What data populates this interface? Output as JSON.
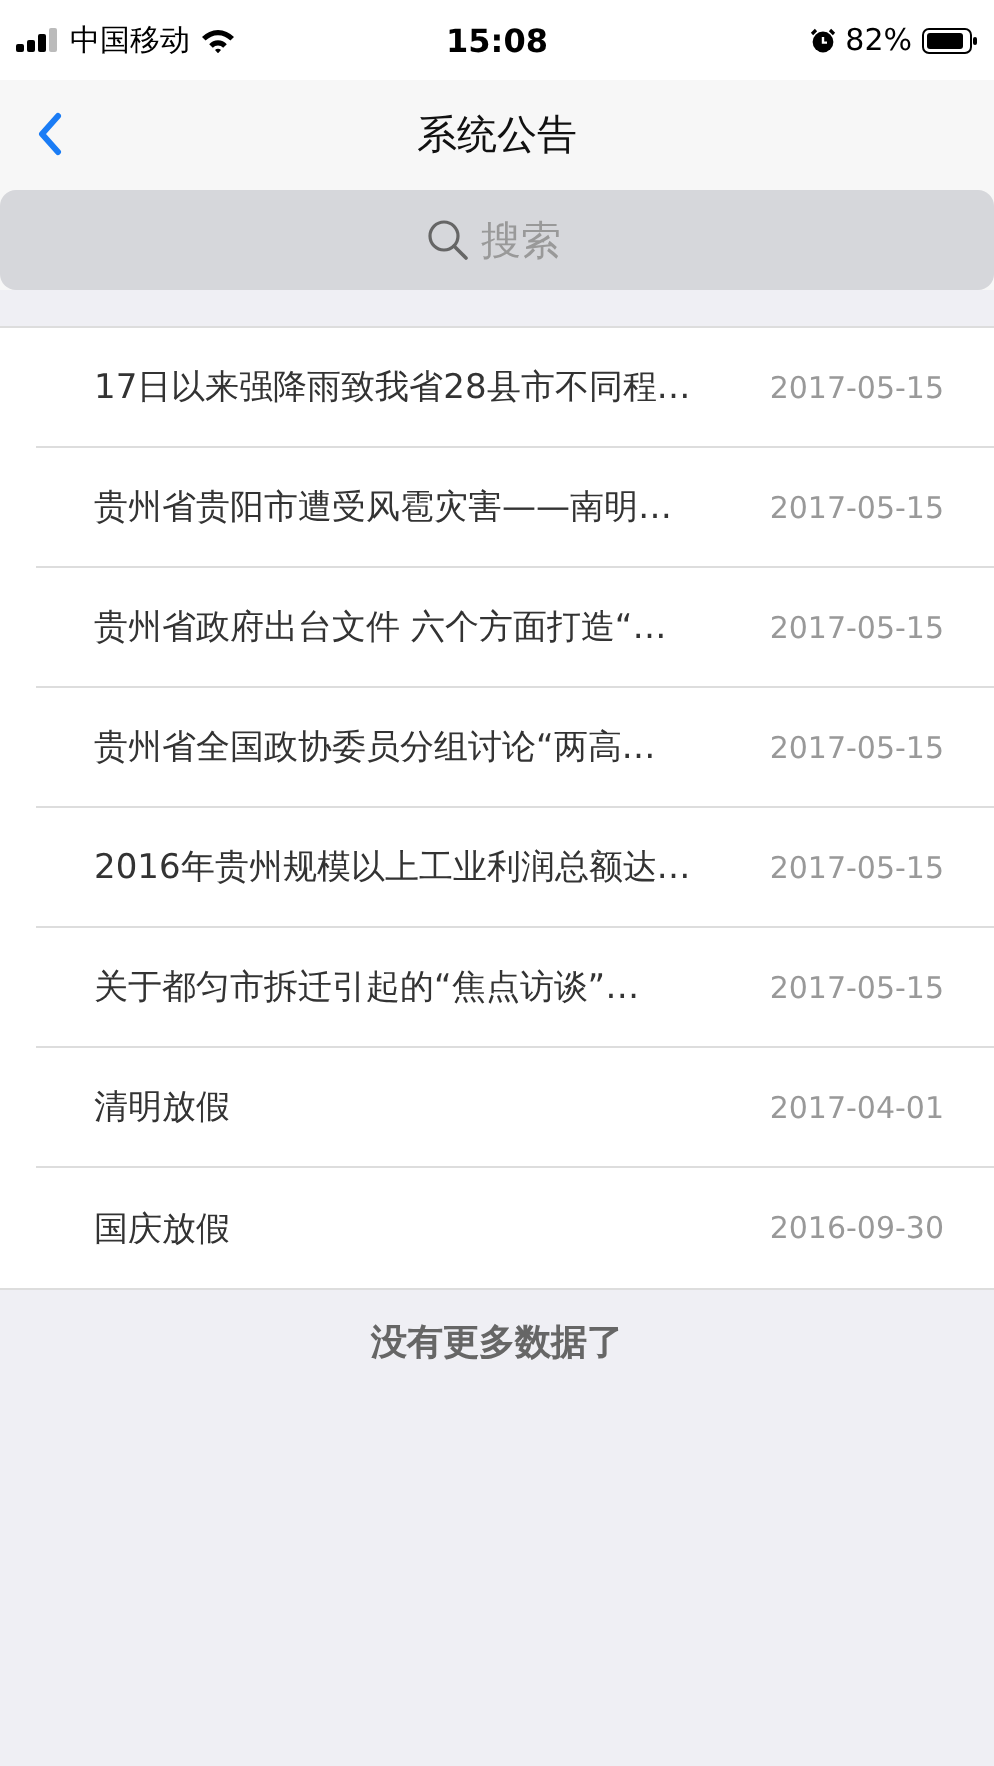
{
  "status_bar": {
    "carrier": "中国移动",
    "time": "15:08",
    "battery": "82%"
  },
  "nav": {
    "title": "系统公告"
  },
  "search": {
    "placeholder": "搜索"
  },
  "notices": [
    {
      "title": "17日以来强降雨致我省28县市不同程…",
      "date": "2017-05-15"
    },
    {
      "title": "贵州省贵阳市遭受风雹灾害——南明…",
      "date": "2017-05-15"
    },
    {
      "title": "贵州省政府出台文件 六个方面打造“…",
      "date": "2017-05-15"
    },
    {
      "title": "贵州省全国政协委员分组讨论“两高…",
      "date": "2017-05-15"
    },
    {
      "title": "2016年贵州规模以上工业利润总额达…",
      "date": "2017-05-15"
    },
    {
      "title": "关于都匀市拆迁引起的“焦点访谈”…",
      "date": "2017-05-15"
    },
    {
      "title": "清明放假",
      "date": "2017-04-01"
    },
    {
      "title": "国庆放假",
      "date": "2016-09-30"
    }
  ],
  "footer": "没有更多数据了"
}
